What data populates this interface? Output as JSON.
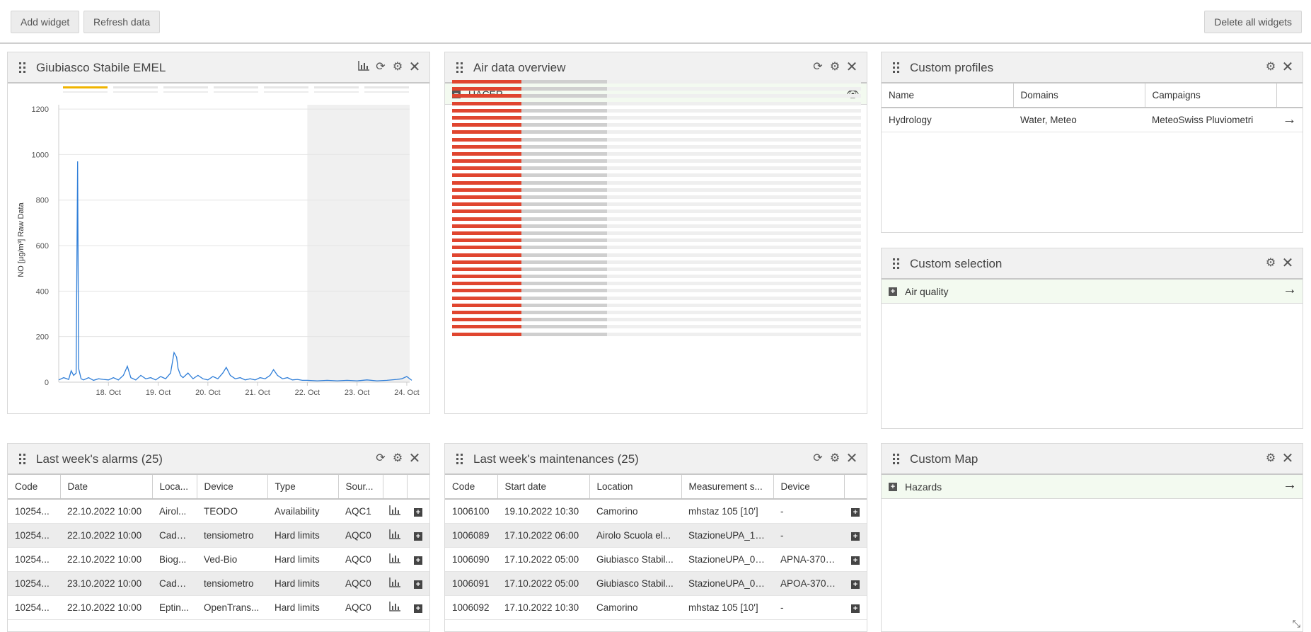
{
  "toolbar": {
    "add_widget": "Add widget",
    "refresh_data": "Refresh data",
    "delete_all": "Delete all widgets"
  },
  "chart_widget": {
    "title": "Giubiasco Stabile EMEL",
    "icons": [
      "chart-icon",
      "refresh-icon",
      "gear-icon",
      "close-icon"
    ]
  },
  "chart_data": {
    "type": "line",
    "ylabel": "NO [µg/m³] Raw Data",
    "ylim": [
      0,
      1250
    ],
    "yticks": [
      "0",
      "200",
      "400",
      "600",
      "800",
      "1000",
      "1200"
    ],
    "xticks": [
      "18. Oct",
      "19. Oct",
      "20. Oct",
      "21. Oct",
      "22. Oct",
      "23. Oct",
      "24. Oct"
    ],
    "series": [
      {
        "color": "#2f7ed8",
        "x": [
          17.0,
          17.1,
          17.2,
          17.25,
          17.3,
          17.35,
          17.38,
          17.4,
          17.45,
          17.5,
          17.6,
          17.7,
          17.8,
          17.9,
          18.0,
          18.1,
          18.2,
          18.3,
          18.38,
          18.45,
          18.55,
          18.65,
          18.75,
          18.85,
          18.95,
          19.05,
          19.15,
          19.25,
          19.32,
          19.37,
          19.4,
          19.45,
          19.5,
          19.6,
          19.7,
          19.8,
          19.9,
          20.0,
          20.1,
          20.2,
          20.3,
          20.37,
          20.45,
          20.55,
          20.65,
          20.75,
          20.85,
          20.95,
          21.05,
          21.15,
          21.25,
          21.32,
          21.4,
          21.5,
          21.6,
          21.7,
          21.8,
          21.9,
          22.0,
          22.2,
          22.4,
          22.6,
          22.8,
          23.0,
          23.2,
          23.4,
          23.6,
          23.8,
          23.9,
          24.0,
          24.1
        ],
        "y": [
          10,
          20,
          12,
          50,
          30,
          40,
          970,
          60,
          15,
          10,
          20,
          8,
          15,
          12,
          10,
          20,
          10,
          30,
          70,
          20,
          10,
          30,
          15,
          20,
          10,
          25,
          15,
          40,
          130,
          110,
          60,
          30,
          20,
          40,
          15,
          30,
          15,
          10,
          25,
          15,
          40,
          65,
          30,
          15,
          20,
          10,
          15,
          10,
          20,
          15,
          30,
          55,
          30,
          15,
          20,
          10,
          12,
          8,
          8,
          6,
          8,
          6,
          8,
          6,
          10,
          6,
          8,
          12,
          15,
          25,
          8
        ]
      }
    ],
    "highlight_band_start": 22.0
  },
  "air_widget": {
    "title": "Air data overview",
    "group": "UACER",
    "rows": 36
  },
  "profiles_widget": {
    "title": "Custom profiles",
    "columns": [
      "Name",
      "Domains",
      "Campaigns"
    ],
    "rows": [
      [
        "Hydrology",
        "Water, Meteo",
        "MeteoSwiss Pluviometri"
      ]
    ]
  },
  "selection_widget": {
    "title": "Custom selection",
    "item": "Air quality"
  },
  "map_widget": {
    "title": "Custom Map",
    "item": "Hazards"
  },
  "alarms_widget": {
    "title": "Last week's alarms (25)",
    "columns": [
      "Code",
      "Date",
      "Loca...",
      "Device",
      "Type",
      "Sour..."
    ],
    "rows": [
      [
        "10254...",
        "22.10.2022 10:00",
        "Airol...",
        "TEODO",
        "Availability",
        "AQC1"
      ],
      [
        "10254...",
        "22.10.2022 10:00",
        "Cade...",
        "tensiometro",
        "Hard limits",
        "AQC0"
      ],
      [
        "10254...",
        "22.10.2022 10:00",
        "Biog...",
        "Ved-Bio",
        "Hard limits",
        "AQC0"
      ],
      [
        "10254...",
        "23.10.2022 10:00",
        "Cade...",
        "tensiometro",
        "Hard limits",
        "AQC0"
      ],
      [
        "10254...",
        "22.10.2022 10:00",
        "Eptin...",
        "OpenTrans...",
        "Hard limits",
        "AQC0"
      ]
    ]
  },
  "maint_widget": {
    "title": "Last week's maintenances (25)",
    "columns": [
      "Code",
      "Start date",
      "Location",
      "Measurement s...",
      "Device"
    ],
    "rows": [
      [
        "1006100",
        "19.10.2022 10:30",
        "Camorino",
        "mhstaz 105 [10']",
        "-"
      ],
      [
        "1006089",
        "17.10.2022 06:00",
        "Airolo Scuola el...",
        "StazioneUPA_12...",
        "-"
      ],
      [
        "1006090",
        "17.10.2022 05:00",
        "Giubiasco Stabil...",
        "StazioneUPA_06...",
        "APNA-370 -..."
      ],
      [
        "1006091",
        "17.10.2022 05:00",
        "Giubiasco Stabil...",
        "StazioneUPA_06...",
        "APOA-370 -..."
      ],
      [
        "1006092",
        "17.10.2022 10:30",
        "Camorino",
        "mhstaz 105 [10']",
        "-"
      ]
    ]
  }
}
